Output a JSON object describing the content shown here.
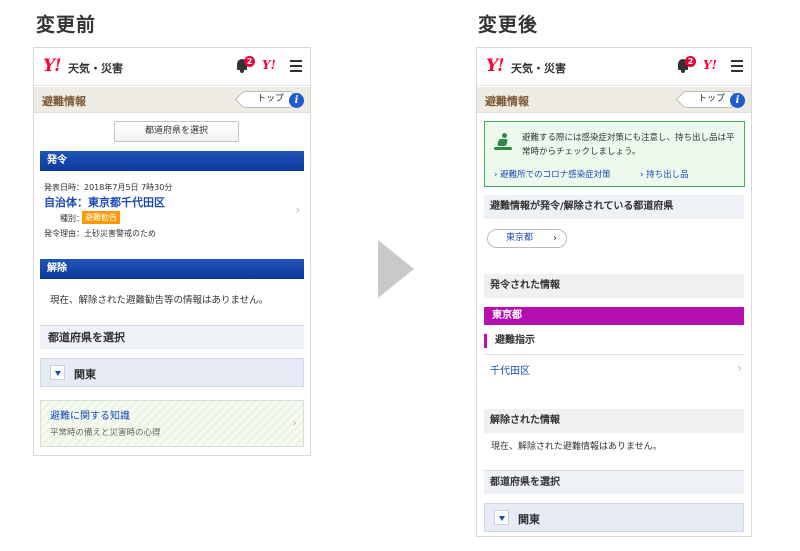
{
  "labels": {
    "before": "変更前",
    "after": "変更後"
  },
  "header": {
    "logo": "Y!",
    "service_name": "天気・災害",
    "notification_count": "2",
    "yahoo_mini": "Y!",
    "section_title": "避難情報",
    "top_label": "トップ",
    "info_glyph": "i"
  },
  "before": {
    "select_pref_button": "都道府県を選択",
    "issued_title": "発令",
    "announce_time": "発表日時：2018年7月5日 7時30分",
    "municipality": "自治体：東京都千代田区",
    "kind_label": "種別：",
    "kind_value": "避難勧告",
    "reason": "発令理由：土砂災害警戒のため",
    "lifted_title": "解除",
    "lifted_text": "現在、解除された避難勧告等の情報はありません。",
    "select_pref_title": "都道府県を選択",
    "region": "関東",
    "knowledge_title": "避難に関する知識",
    "knowledge_sub": "平常時の備えと災害時の心得"
  },
  "after": {
    "notice_text": "避難する際には感染症対策にも注意し、持ち出し品は平常時からチェックしましょう。",
    "link_corona": "› 避難所でのコロナ感染症対策",
    "link_items": "› 持ち出し品",
    "pref_header": "避難情報が発令/解除されている都道府県",
    "pref_pill": "東京都",
    "issued_header": "発令された情報",
    "pref_name": "東京都",
    "instruction": "避難指示",
    "city": "千代田区",
    "lifted_header": "解除された情報",
    "lifted_text": "現在、解除された避難情報はありません。",
    "select_pref_title": "都道府県を選択",
    "region": "関東"
  },
  "colors": {
    "brand": "#ff0033",
    "blue_bar": "#0a3a9c",
    "purple": "#b511b0",
    "notice_green": "#46a85a"
  },
  "icons": [
    "bell-icon",
    "menu-icon",
    "info-icon",
    "evacuation-person-icon",
    "chevron-right-icon",
    "triangle-down-icon",
    "arrow-right-icon"
  ]
}
